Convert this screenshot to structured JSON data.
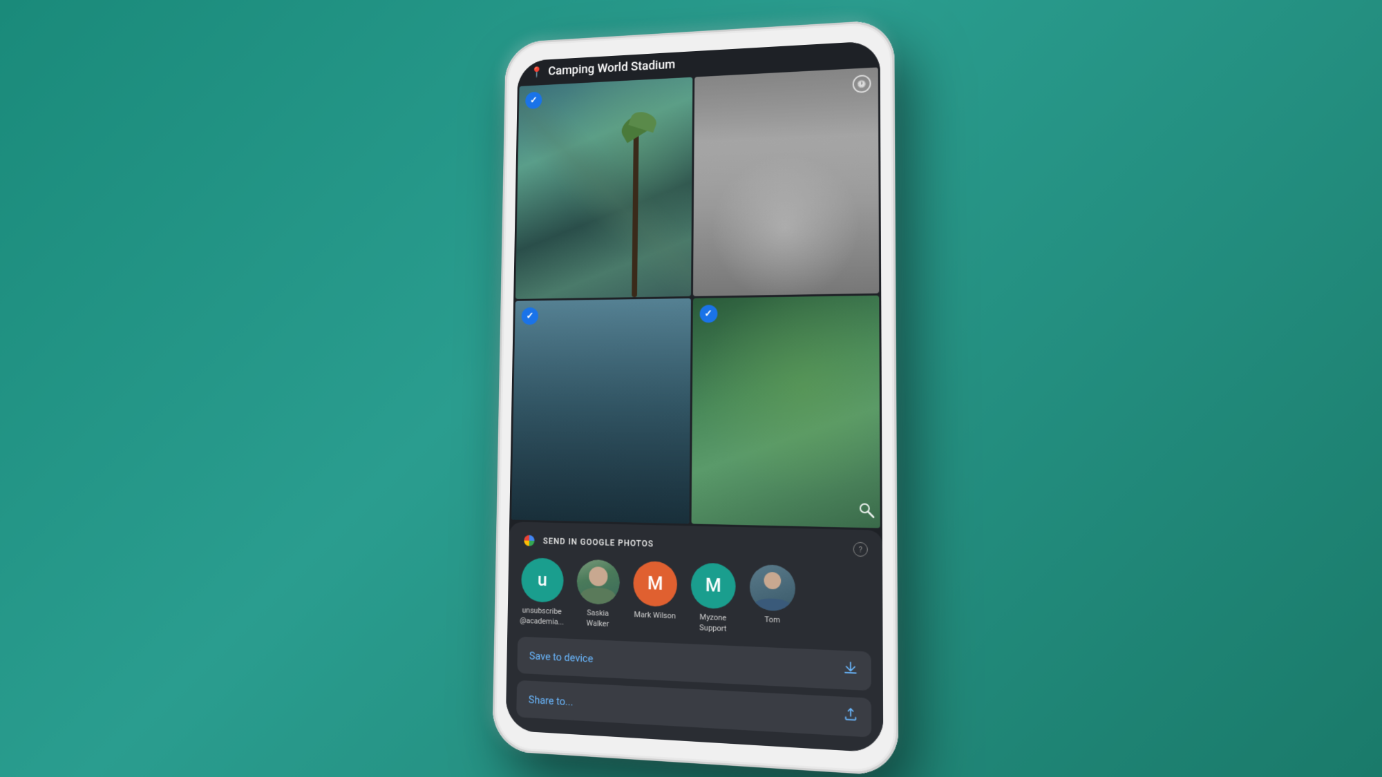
{
  "background": {
    "color_start": "#1a8a7a",
    "color_end": "#1a7a6a"
  },
  "phone": {
    "screen_bg": "#1e2126"
  },
  "header": {
    "location_name": "Camping World Stadium"
  },
  "photos": [
    {
      "id": 1,
      "checked": true,
      "type": "palm_building",
      "row": 1,
      "col": 1
    },
    {
      "id": 2,
      "checked": false,
      "type": "bw_city",
      "row": 1,
      "col": 2,
      "has_clock": true
    },
    {
      "id": 3,
      "checked": true,
      "type": "trees",
      "row": 2,
      "col": 1
    },
    {
      "id": 4,
      "checked": true,
      "type": "palm_green",
      "row": 2,
      "col": 2
    }
  ],
  "bottom_sheet": {
    "section_label": "SEND IN GOOGLE PHOTOS",
    "contacts": [
      {
        "id": "u",
        "name": "unsubscribe\n@academia...",
        "initial": "u",
        "color": "teal",
        "type": "initial"
      },
      {
        "id": "saskia",
        "name": "Saskia\nWalker",
        "color": "photo",
        "type": "photo"
      },
      {
        "id": "mark",
        "name": "Mark Wilson",
        "initial": "M",
        "color": "orange",
        "type": "initial"
      },
      {
        "id": "myzone",
        "name": "Myzone\nSupport",
        "initial": "M",
        "color": "teal2",
        "type": "initial"
      },
      {
        "id": "tom",
        "name": "Tom",
        "color": "photo",
        "type": "photo_partial"
      }
    ],
    "actions": [
      {
        "id": "save",
        "label": "Save to device",
        "icon": "⬇"
      },
      {
        "id": "share",
        "label": "Share to...",
        "icon": "⬆"
      }
    ]
  }
}
